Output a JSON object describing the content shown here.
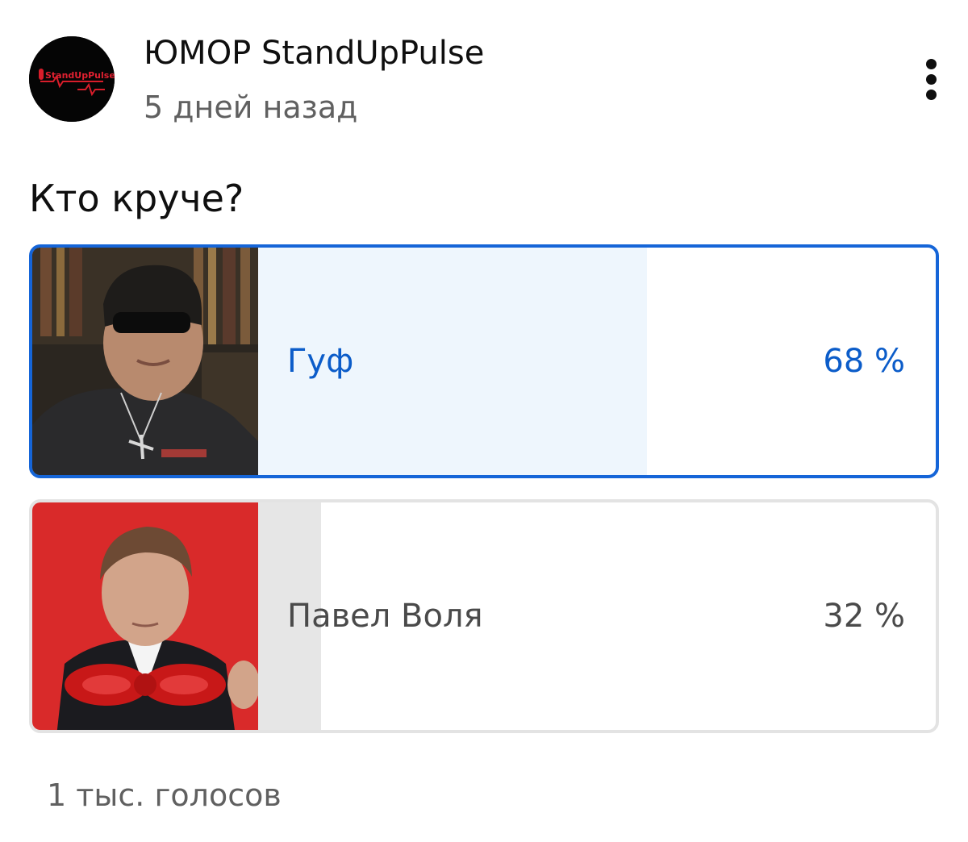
{
  "post": {
    "channel_name": "ЮМОР StandUpPulse",
    "avatar_logo_text": "StandUpPulse",
    "time_ago": "5 дней назад",
    "more_icon": "more-vertical-icon"
  },
  "poll": {
    "question": "Кто круче?",
    "options": [
      {
        "label": "Гуф",
        "percent_text": "68 %",
        "share": 0.68,
        "selected": true
      },
      {
        "label": "Павел Воля",
        "percent_text": "32 %",
        "share": 0.32,
        "selected": false
      }
    ],
    "votes_text": "1 тыс. голосов"
  },
  "colors": {
    "accent": "#1565d8",
    "accent_text": "#0b5cc9",
    "selected_fill": "#eef6fd",
    "unselected_fill": "#e6e6e6",
    "unselected_border": "#e3e3e3",
    "muted_text": "#606060"
  }
}
